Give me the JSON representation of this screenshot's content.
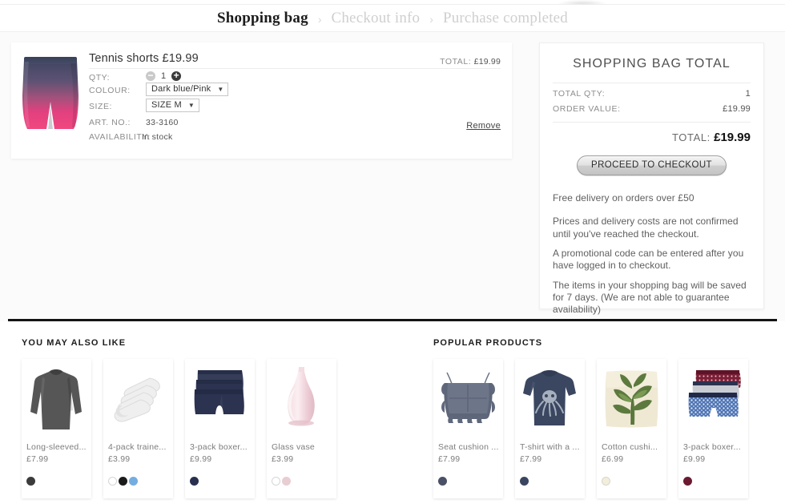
{
  "breadcrumb": {
    "steps": [
      {
        "label": "Shopping bag",
        "state": "active"
      },
      {
        "label": "Checkout info",
        "state": "inactive"
      },
      {
        "label": "Purchase completed",
        "state": "inactive"
      }
    ],
    "separator": "›"
  },
  "cart_item": {
    "title": "Tennis shorts £19.99",
    "qty_label": "QTY:",
    "qty_value": "1",
    "minus_glyph": "−",
    "plus_glyph": "+",
    "colour_label": "COLOUR:",
    "colour_value": "Dark blue/Pink",
    "size_label": "SIZE:",
    "size_value": "SIZE  M",
    "art_label": "ART. NO.:",
    "art_value": "33-3160",
    "availability_label": "AVAILABILITY:",
    "availability_value": "In stock",
    "total_label": "TOTAL:",
    "total_value": "£19.99",
    "remove_label": "Remove",
    "caret": "▼",
    "image_alt": "tennis-shorts-dark-blue-pink"
  },
  "totals": {
    "title": "SHOPPING BAG TOTAL",
    "rows": [
      {
        "label": "TOTAL QTY:",
        "value": "1"
      },
      {
        "label": "ORDER VALUE:",
        "value": "£19.99"
      }
    ],
    "grand_label": "TOTAL:",
    "grand_value": "£19.99",
    "checkout_label": "PROCEED TO CHECKOUT",
    "info_free_delivery": "Free delivery on orders over £50",
    "info_paragraphs": [
      "Prices and delivery costs are not confirmed until you've reached the checkout.",
      "A promotional code can be entered after you have logged in to checkout.",
      "The items in your shopping bag will be saved for 7 days. (We are not able to guarantee availability)"
    ]
  },
  "recommendations": {
    "left": {
      "heading": "YOU MAY ALSO LIKE",
      "items": [
        {
          "name": "Long-sleeved...",
          "price": "£7.99",
          "image": "grey-long-sleeve-top",
          "swatches": [
            "#3b3b3b"
          ]
        },
        {
          "name": "4-pack traine...",
          "price": "£3.99",
          "image": "white-trainer-socks",
          "swatches": [
            "#ffffff",
            "#1b1b1b",
            "#74aee0"
          ]
        },
        {
          "name": "3-pack boxer...",
          "price": "£9.99",
          "image": "navy-boxer-shorts",
          "swatches": [
            "#28304f"
          ]
        },
        {
          "name": "Glass vase",
          "price": "£3.99",
          "image": "pink-glass-vase",
          "swatches": [
            "#ffffff",
            "#e8cdd2"
          ]
        }
      ]
    },
    "right": {
      "heading": "POPULAR PRODUCTS",
      "items": [
        {
          "name": "Seat cushion ...",
          "price": "£7.99",
          "image": "grey-ruffled-seat-cushion",
          "swatches": [
            "#4a5166"
          ]
        },
        {
          "name": "T-shirt with a ...",
          "price": "£7.99",
          "image": "navy-octopus-tshirt",
          "swatches": [
            "#3a4560"
          ]
        },
        {
          "name": "Cotton cushi...",
          "price": "£6.99",
          "image": "palm-leaf-cotton-cushion",
          "swatches": [
            "#f2eed8"
          ]
        },
        {
          "name": "3-pack boxer...",
          "price": "£9.99",
          "image": "patterned-boxer-shorts",
          "swatches": [
            "#6b1a31"
          ]
        }
      ]
    }
  },
  "colors": {
    "divider": "#141414",
    "page_bg": "#fbfbfb",
    "muted_text": "#8d8d8d"
  }
}
